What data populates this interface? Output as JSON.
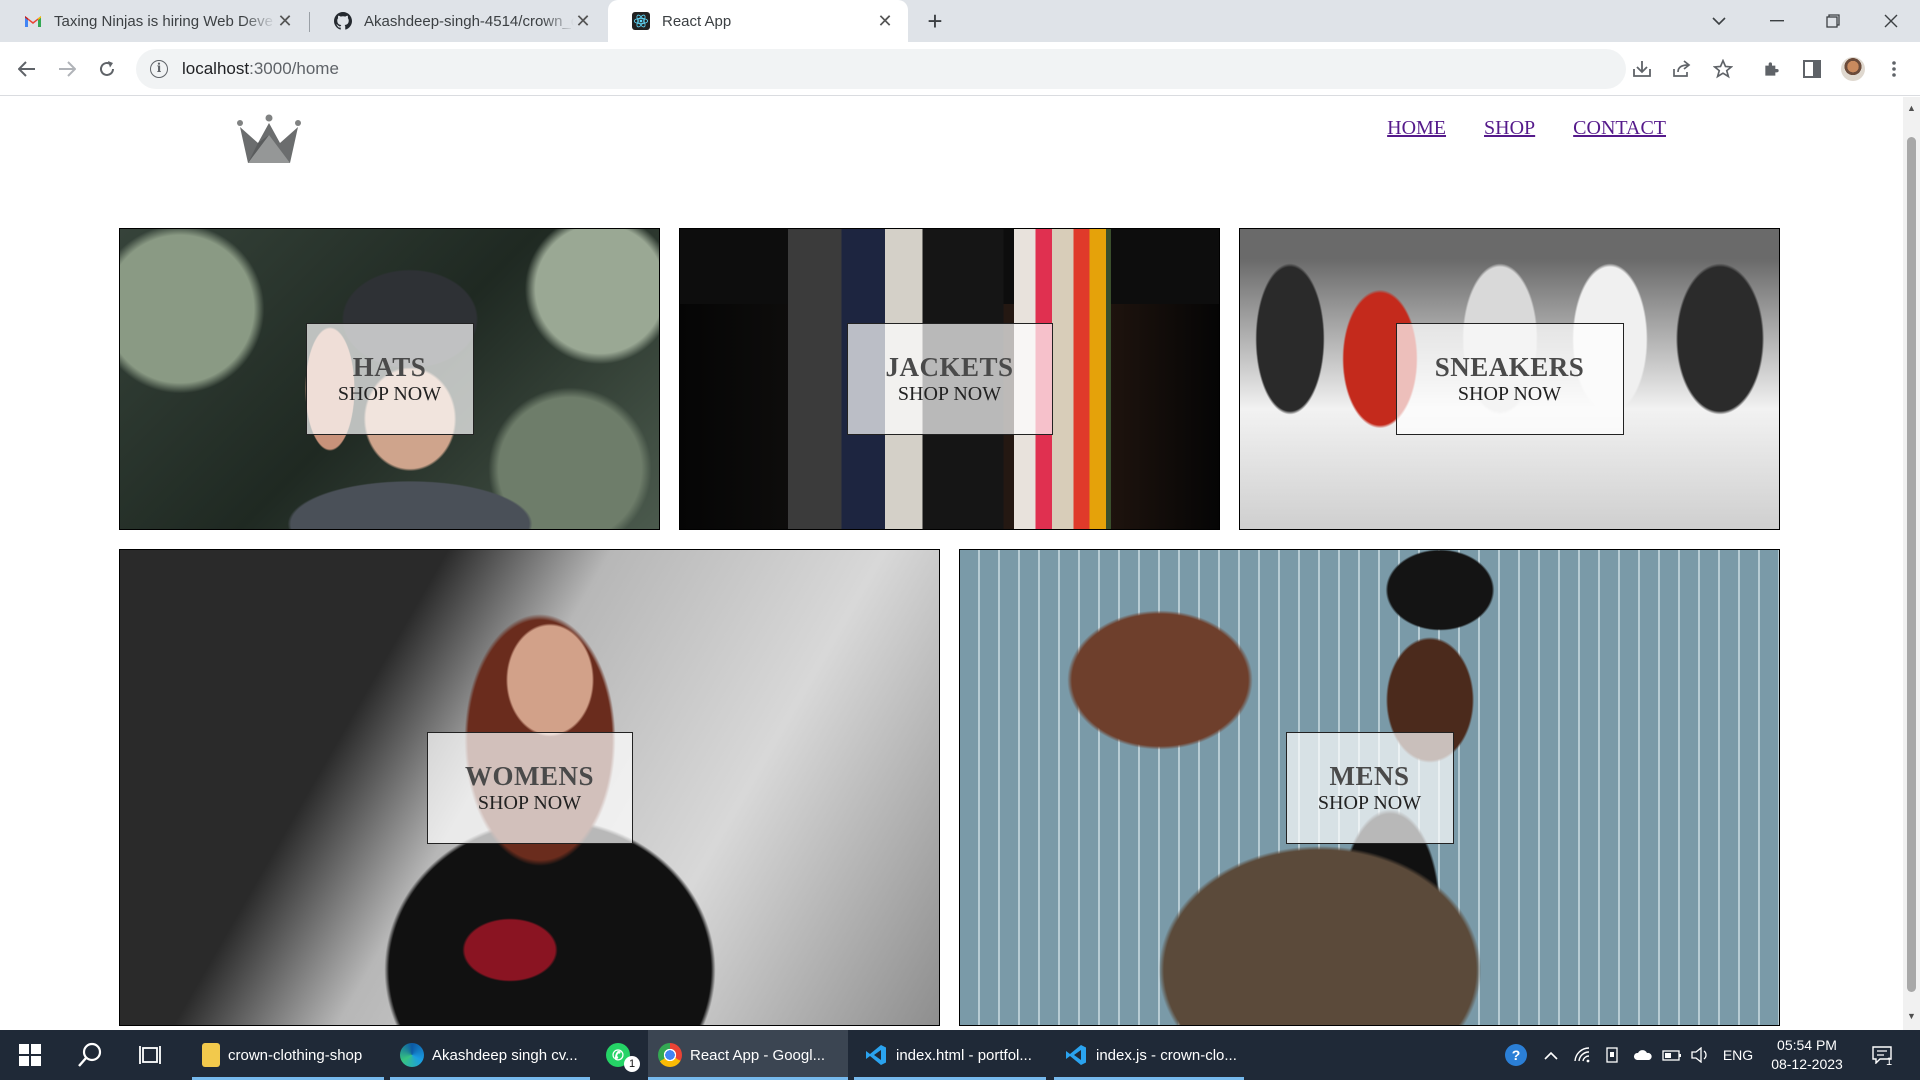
{
  "browser": {
    "tabs": [
      {
        "title": "Taxing Ninjas is hiring Web Deve",
        "icon": "gmail-icon"
      },
      {
        "title": "Akashdeep-singh-4514/crown_c",
        "icon": "github-icon"
      },
      {
        "title": "React App",
        "icon": "react-icon"
      }
    ],
    "url_host": "localhost",
    "url_path": ":3000/home"
  },
  "site": {
    "nav": [
      "HOME",
      "SHOP",
      "CONTACT"
    ],
    "nav_color": "#551a8b",
    "categories": [
      {
        "title": "HATS",
        "subtitle": "SHOP NOW"
      },
      {
        "title": "JACKETS",
        "subtitle": "SHOP NOW"
      },
      {
        "title": "SNEAKERS",
        "subtitle": "SHOP NOW"
      },
      {
        "title": "WOMENS",
        "subtitle": "SHOP NOW"
      },
      {
        "title": "MENS",
        "subtitle": "SHOP NOW"
      }
    ]
  },
  "taskbar": {
    "apps": [
      {
        "label": "crown-clothing-shop",
        "icon": "folder-icon"
      },
      {
        "label": "Akashdeep singh cv...",
        "icon": "edge-icon"
      },
      {
        "label": "",
        "icon": "whatsapp-icon",
        "badge": "1"
      },
      {
        "label": "React App - Googl...",
        "icon": "chrome-icon"
      },
      {
        "label": "index.html - portfol...",
        "icon": "vscode-icon"
      },
      {
        "label": "index.js - crown-clo...",
        "icon": "vscode-icon"
      }
    ],
    "language": "ENG",
    "time": "05:54 PM",
    "date": "08-12-2023",
    "notification_count": "1"
  }
}
